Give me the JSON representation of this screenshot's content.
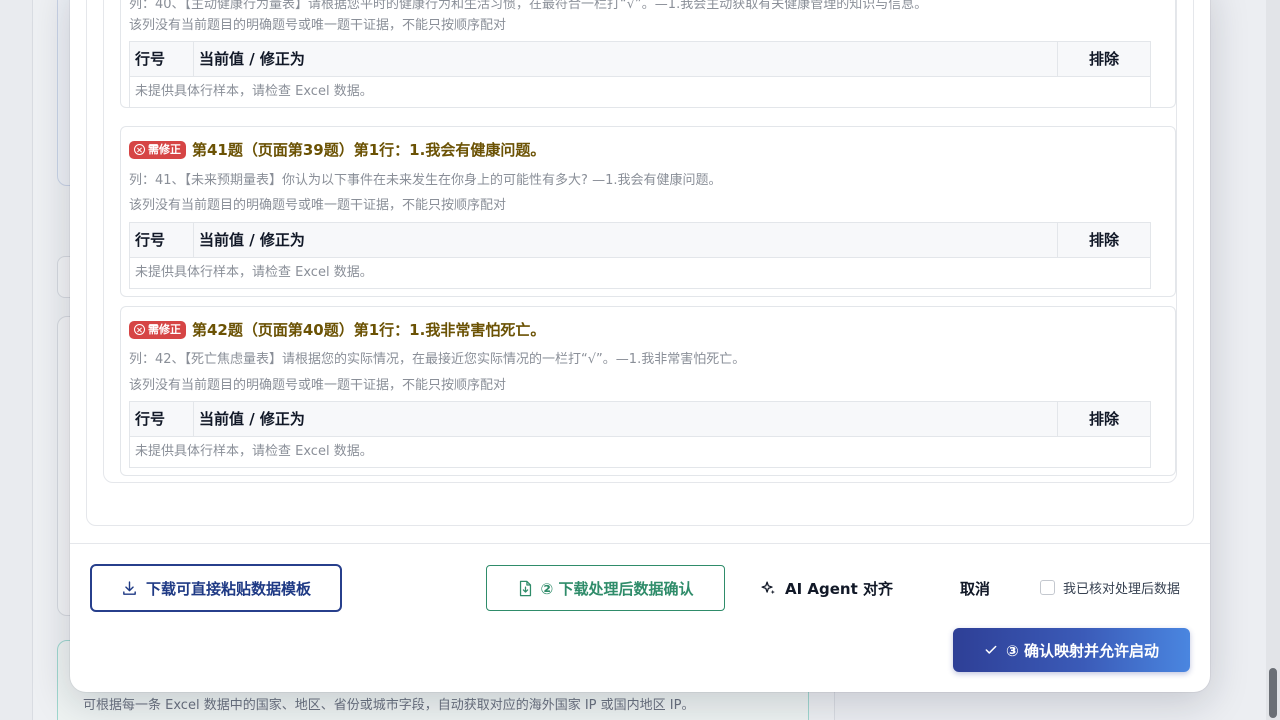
{
  "background": {
    "note": "可根据每一条 Excel 数据中的国家、地区、省份或城市字段，自动获取对应的海外国家 IP 或国内地区 IP。"
  },
  "top_partial": {
    "col": "列：40、【主动健康行为量表】请根据您平时的健康行为和生活习惯，在最符合一栏打“√”。—1.我会主动获取有关健康管理的知识与信息。",
    "warn": "该列没有当前题目的明确题号或唯一题干证据，不能只按顺序配对",
    "table": {
      "h_row": "行号",
      "h_value": "当前值 / 修正为",
      "h_exclude": "排除",
      "empty": "未提供具体行样本，请检查 Excel 数据。"
    }
  },
  "questions": [
    {
      "badge": "需修正",
      "title": "第41题（页面第39题）第1行：1.我会有健康问题。",
      "col": "列：41、【未来预期量表】你认为以下事件在未来发生在你身上的可能性有多大? —1.我会有健康问题。",
      "warn": "该列没有当前题目的明确题号或唯一题干证据，不能只按顺序配对",
      "table": {
        "h_row": "行号",
        "h_value": "当前值 / 修正为",
        "h_exclude": "排除",
        "empty": "未提供具体行样本，请检查 Excel 数据。"
      }
    },
    {
      "badge": "需修正",
      "title": "第42题（页面第40题）第1行：1.我非常害怕死亡。",
      "col": "列：42、【死亡焦虑量表】请根据您的实际情况，在最接近您实际情况的一栏打“√”。—1.我非常害怕死亡。",
      "warn": "该列没有当前题目的明确题号或唯一题干证据，不能只按顺序配对",
      "table": {
        "h_row": "行号",
        "h_value": "当前值 / 修正为",
        "h_exclude": "排除",
        "empty": "未提供具体行样本，请检查 Excel 数据。"
      }
    }
  ],
  "footer": {
    "template_btn": "下载可直接粘贴数据模板",
    "download_btn": "② 下载处理后数据确认",
    "ai_btn": "AI Agent 对齐",
    "cancel_btn": "取消",
    "check_label": "我已核对处理后数据",
    "confirm_btn": "③ 确认映射并允许启动"
  },
  "colors": {
    "badge": "#d64545",
    "title": "#6b5204",
    "primary": "#2e3f96",
    "success": "#2f8c6a"
  }
}
